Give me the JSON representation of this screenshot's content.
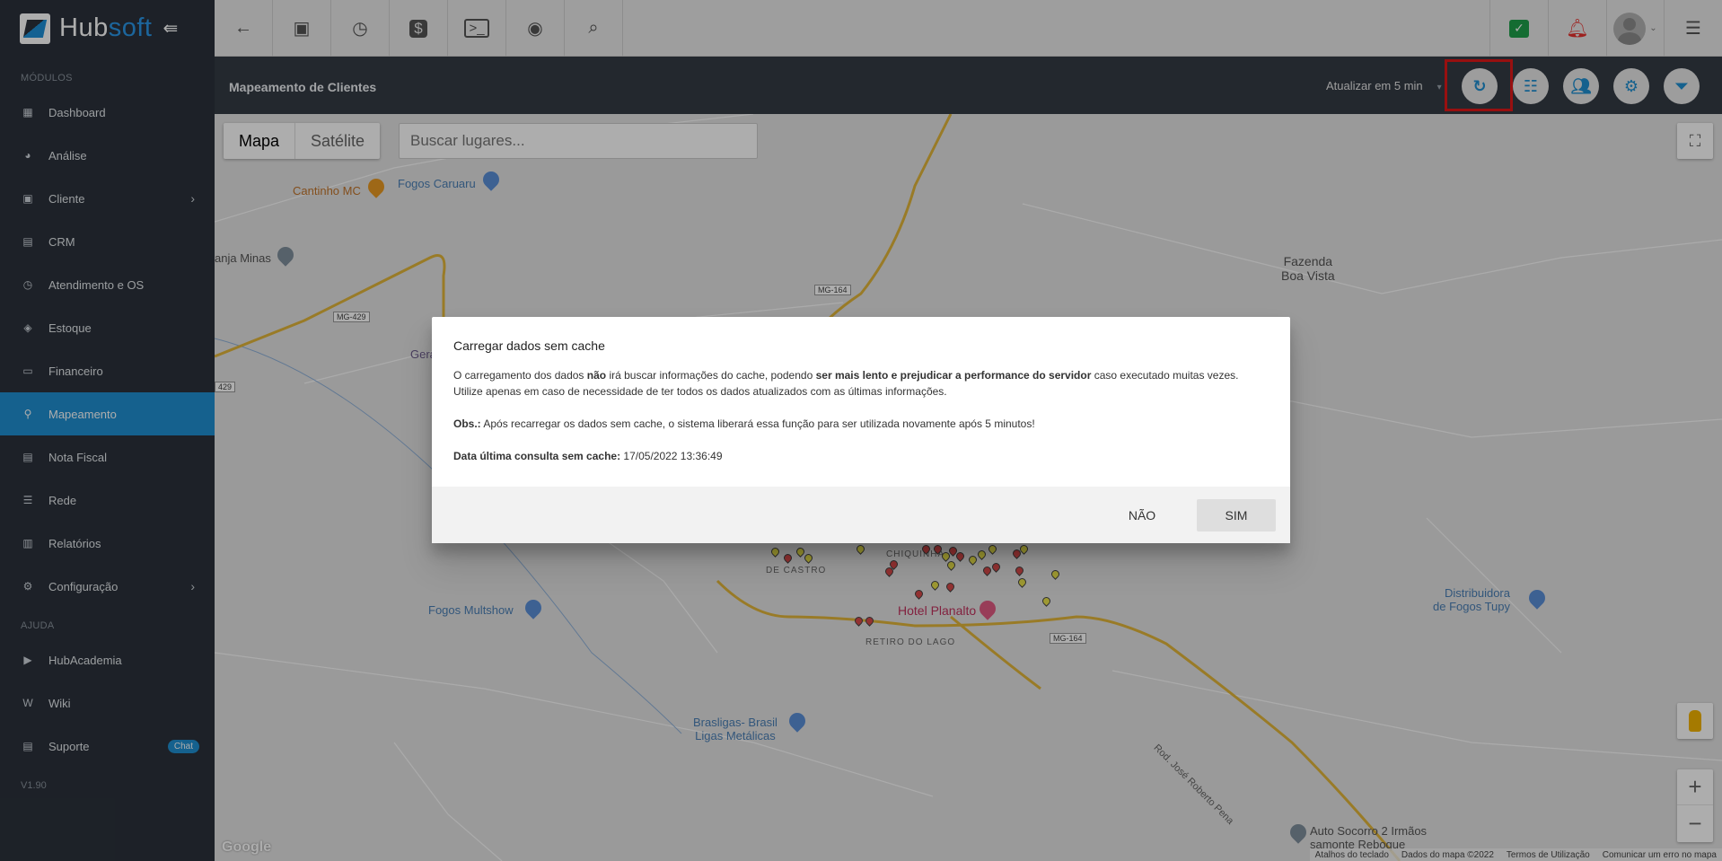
{
  "brand": {
    "name_part1": "Hub",
    "name_part2": "soft"
  },
  "sidebar": {
    "section_modules": "MÓDULOS",
    "items": [
      {
        "label": "Dashboard",
        "icon": "dashboard-icon"
      },
      {
        "label": "Análise",
        "icon": "chart-pie-icon"
      },
      {
        "label": "Cliente",
        "icon": "client-card-icon"
      },
      {
        "label": "CRM",
        "icon": "crm-icon"
      },
      {
        "label": "Atendimento e OS",
        "icon": "calendar-clock-icon"
      },
      {
        "label": "Estoque",
        "icon": "box-icon"
      },
      {
        "label": "Financeiro",
        "icon": "money-icon"
      },
      {
        "label": "Mapeamento",
        "icon": "map-pin-icon"
      },
      {
        "label": "Nota Fiscal",
        "icon": "invoice-icon"
      },
      {
        "label": "Rede",
        "icon": "network-icon"
      },
      {
        "label": "Relatórios",
        "icon": "report-icon"
      },
      {
        "label": "Configuração",
        "icon": "gear-icon"
      }
    ],
    "section_help": "AJUDA",
    "help_items": [
      {
        "label": "HubAcademia",
        "icon": "youtube-icon"
      },
      {
        "label": "Wiki",
        "icon": "wiki-icon"
      },
      {
        "label": "Suporte",
        "icon": "chat-icon",
        "badge": "Chat"
      }
    ],
    "version": "V1.90"
  },
  "header": {
    "title": "Mapeamento de Clientes",
    "refresh_label": "Atualizar em 5 min"
  },
  "map": {
    "toggle_map": "Mapa",
    "toggle_satellite": "Satélite",
    "search_placeholder": "Buscar lugares...",
    "labels": {
      "cantinho": "Cantinho MC",
      "fogos_caruaru": "Fogos Caruaru",
      "anja_minas": "anja Minas",
      "geraldo": "Geraldo /",
      "fazenda1": "Fazenda",
      "fazenda2": "Boa Vista",
      "fogos_multshow": "Fogos Multshow",
      "hotel": "Hotel Planalto",
      "retiro": "RETIRO DO LAGO",
      "chiquinha": "CHIQUINHA",
      "castro": "DE CASTRO",
      "brasligas1": "Brasligas- Brasil",
      "brasligas2": "Ligas Metálicas",
      "distribuidora1": "Distribuidora",
      "distribuidora2": "de Fogos Tupy",
      "auto1": "Auto Socorro 2 Irmãos",
      "auto2": "samonte Reboque",
      "rod": "Rod. José Roberto Pena",
      "mg164a": "MG-164",
      "mg164b": "MG-164",
      "mg429": "MG-429",
      "r429": "429"
    },
    "google": "Google",
    "attribution": {
      "shortcuts": "Atalhos do teclado",
      "data": "Dados do mapa ©2022",
      "terms": "Termos de Utilização",
      "report": "Comunicar um erro no mapa"
    }
  },
  "dialog": {
    "title": "Carregar dados sem cache",
    "p1_a": "O carregamento dos dados ",
    "p1_b": "não",
    "p1_c": " irá buscar informações do cache, podendo ",
    "p1_d": "ser mais lento e prejudicar a performance do servidor",
    "p1_e": " caso executado muitas vezes.",
    "p1_f": "Utilize apenas em caso de necessidade de ter todos os dados atualizados com as últimas informações.",
    "obs_label": "Obs.:",
    "obs_text": " Após recarregar os dados sem cache, o sistema liberará essa função para ser utilizada novamente após 5 minutos!",
    "last_label": "Data última consulta sem cache:",
    "last_value": " 17/05/2022 13:36:49",
    "btn_no": "NÃO",
    "btn_yes": "SIM"
  },
  "colors": {
    "sidebar_bg": "#2b323b",
    "accent": "#1f8fd1",
    "header_bg": "#343b45",
    "highlight": "#e01919"
  }
}
